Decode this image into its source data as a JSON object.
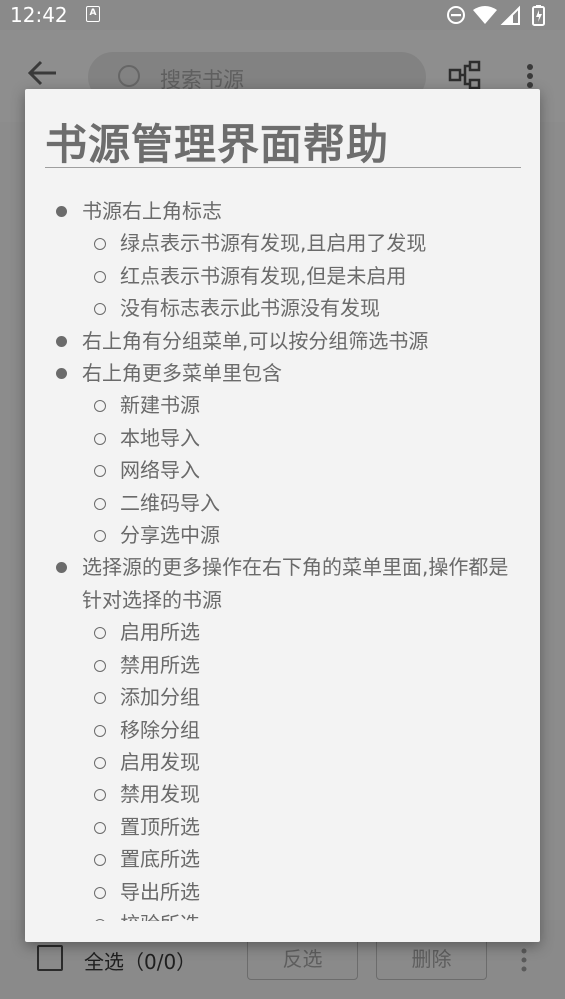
{
  "status_bar": {
    "time": "12:42",
    "app_icon_letter": "A",
    "icons": [
      "do-not-disturb-icon",
      "wifi-icon",
      "signal-icon",
      "battery-charging-icon"
    ]
  },
  "app_bar": {
    "search_placeholder": "搜索书源",
    "icons": [
      "back-arrow-icon",
      "search-icon",
      "group-filter-icon",
      "more-vert-icon"
    ]
  },
  "bottom_bar": {
    "select_all_label": "全选（0/0）",
    "invert_label": "反选",
    "delete_label": "删除"
  },
  "dialog": {
    "title": "书源管理界面帮助",
    "items": [
      {
        "level": 1,
        "text": "书源右上角标志"
      },
      {
        "level": 2,
        "text": "绿点表示书源有发现,且启用了发现"
      },
      {
        "level": 2,
        "text": "红点表示书源有发现,但是未启用"
      },
      {
        "level": 2,
        "text": "没有标志表示此书源没有发现"
      },
      {
        "level": 1,
        "text": "右上角有分组菜单,可以按分组筛选书源"
      },
      {
        "level": 1,
        "text": "右上角更多菜单里包含"
      },
      {
        "level": 2,
        "text": "新建书源"
      },
      {
        "level": 2,
        "text": "本地导入"
      },
      {
        "level": 2,
        "text": "网络导入"
      },
      {
        "level": 2,
        "text": "二维码导入"
      },
      {
        "level": 2,
        "text": "分享选中源"
      },
      {
        "level": 1,
        "text": "选择源的更多操作在右下角的菜单里面,操作都是针对选择的书源"
      },
      {
        "level": 2,
        "text": "启用所选"
      },
      {
        "level": 2,
        "text": "禁用所选"
      },
      {
        "level": 2,
        "text": "添加分组"
      },
      {
        "level": 2,
        "text": "移除分组"
      },
      {
        "level": 2,
        "text": "启用发现"
      },
      {
        "level": 2,
        "text": "禁用发现"
      },
      {
        "level": 2,
        "text": "置顶所选"
      },
      {
        "level": 2,
        "text": "置底所选"
      },
      {
        "level": 2,
        "text": "导出所选"
      },
      {
        "level": 2,
        "text": "校验所选"
      }
    ]
  }
}
